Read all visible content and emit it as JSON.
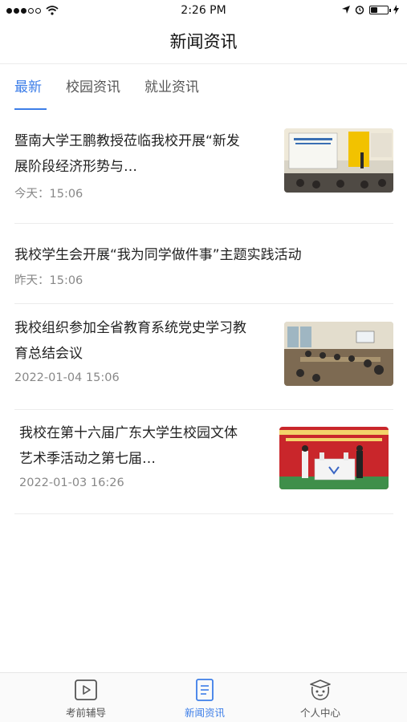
{
  "status_bar": {
    "time": "2:26 PM"
  },
  "header": {
    "title": "新闻资讯"
  },
  "tabs": [
    {
      "label": "最新",
      "active": true
    },
    {
      "label": "校园资讯",
      "active": false
    },
    {
      "label": "就业资讯",
      "active": false
    }
  ],
  "news": [
    {
      "title_line1": "暨南大学王鹏教授莅临我校开展“新发",
      "title_line2": "展阶段经济形势与…",
      "time": "今天：15:06",
      "has_thumb": true
    },
    {
      "title_line1": "我校学生会开展“我为同学做件事”主题实践活动",
      "time": "昨天：15:06",
      "has_thumb": false
    },
    {
      "title_line1": "我校组织参加全省教育系统党史学习教",
      "title_line2": "育总结会议",
      "time": "2022-01-04  15:06",
      "has_thumb": true
    },
    {
      "title_line1": "我校在第十六届广东大学生校园文体",
      "title_line2": "艺术季活动之第七届…",
      "time": "2022-01-03  16:26",
      "has_thumb": true
    }
  ],
  "tabbar": [
    {
      "label": "考前辅导",
      "icon": "video-play-icon",
      "active": false
    },
    {
      "label": "新闻资讯",
      "icon": "document-icon",
      "active": true
    },
    {
      "label": "个人中心",
      "icon": "mascot-face-icon",
      "active": false
    }
  ],
  "colors": {
    "accent": "#3d7ee8",
    "text": "#222222",
    "muted": "#888888"
  }
}
